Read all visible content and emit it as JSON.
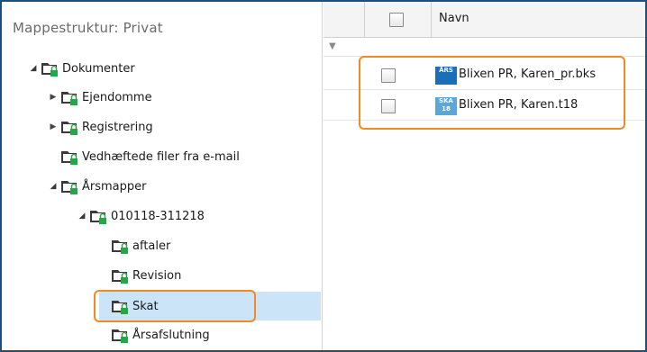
{
  "tree": {
    "title": "Mappestruktur: Privat",
    "items": [
      {
        "label": "Dokumenter",
        "state": "expanded"
      },
      {
        "label": "Ejendomme",
        "state": "collapsed"
      },
      {
        "label": "Registrering",
        "state": "collapsed"
      },
      {
        "label": "Vedhæftede filer fra e-mail",
        "state": "leaf"
      },
      {
        "label": "Årsmapper",
        "state": "expanded"
      },
      {
        "label": "010118-311218",
        "state": "expanded"
      },
      {
        "label": "aftaler",
        "state": "leaf"
      },
      {
        "label": "Revision",
        "state": "leaf"
      },
      {
        "label": "Skat",
        "state": "selected"
      },
      {
        "label": "Årsafslutning",
        "state": "leaf"
      }
    ]
  },
  "list": {
    "columns": [
      "Navn"
    ],
    "files": [
      {
        "icon_text": "ÅRS",
        "icon_color": "#1b6fb8",
        "name": "Blixen PR, Karen_pr.bks"
      },
      {
        "icon_text": "SKA 18",
        "icon_color": "#5aa7d8",
        "name": "Blixen PR, Karen.t18"
      }
    ]
  },
  "colors": {
    "highlight": "#f08a24",
    "selection": "#cce4f7",
    "frame": "#1f4e79"
  }
}
